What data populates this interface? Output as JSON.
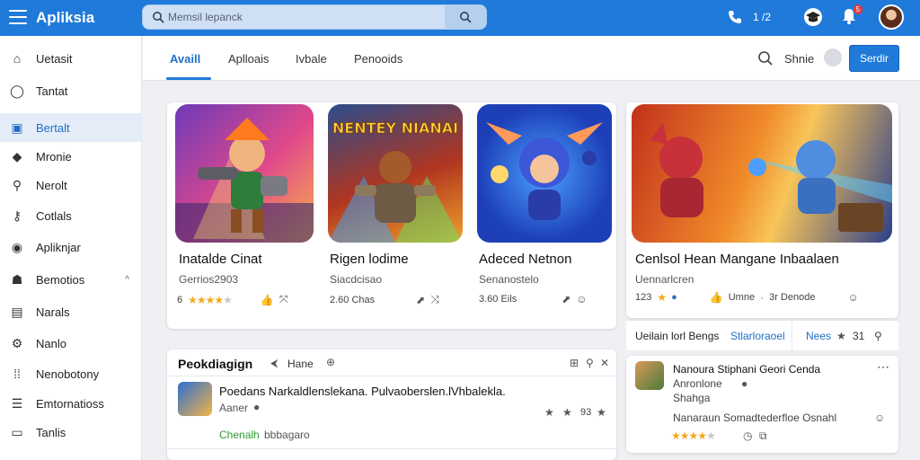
{
  "header": {
    "app_title": "Apliksia",
    "search_placeholder": "Memsil lepanck",
    "phone_number": "1 /2",
    "notification_count": "5"
  },
  "sidebar": {
    "items": [
      {
        "label": "Uetasit",
        "icon": "home-icon"
      },
      {
        "label": "Tantat",
        "icon": "chat-icon"
      },
      {
        "label": "Bertalt",
        "icon": "grid-icon",
        "active": true
      },
      {
        "label": "Mronie",
        "icon": "tag-icon"
      },
      {
        "label": "Nerolt",
        "icon": "search-icon"
      },
      {
        "label": "Cotlals",
        "icon": "key-icon"
      },
      {
        "label": "Apliknjar",
        "icon": "eye-icon"
      },
      {
        "label": "Bemotios",
        "icon": "users-icon",
        "chevron": "^"
      },
      {
        "label": "Narals",
        "icon": "image-icon"
      },
      {
        "label": "Nanlo",
        "icon": "settings-icon"
      },
      {
        "label": "Nenobotony",
        "icon": "apps-icon"
      },
      {
        "label": "Emtornatioss",
        "icon": "list-icon"
      },
      {
        "label": "Tanlis",
        "icon": "monitor-icon"
      }
    ]
  },
  "tabs": {
    "items": [
      {
        "label": "Availl",
        "active": true
      },
      {
        "label": "Aplloais"
      },
      {
        "label": "Ivbale"
      },
      {
        "label": "Penooids"
      }
    ],
    "search_link": "Shnie",
    "button_label": "Serdir"
  },
  "featured": {
    "games": [
      {
        "name": "Inatalde Cinat",
        "developer": "Gerrios2903",
        "rating_text": "6",
        "rating": 4,
        "stats": ""
      },
      {
        "name": "Rigen lodime",
        "developer": "Siacdcisao",
        "rating_text": "",
        "rating": 0,
        "stats": "2.60 Chas"
      },
      {
        "name": "Adeced Netnon",
        "developer": "Senanostelo",
        "rating_text": "",
        "rating": 0,
        "stats": "3.60 Eils"
      }
    ],
    "wide": {
      "name": "Cenlsol Hean Manganе Inbaalaen",
      "developer": "Uennarlcren",
      "rating_text": "123",
      "meta_1": "Umne",
      "meta_2": "3r Denode"
    },
    "thumb_titles": [
      "NENTEY NIANAI"
    ]
  },
  "strip": {
    "label": "Ueilain lorl Bengs",
    "link": "Stlarloraoel",
    "news": "Nees",
    "count": "31"
  },
  "lower_left": {
    "title": "Peokdiagign",
    "action": "Hane",
    "item_title": "Poedans Narkaldlenslekana. Pulvaoberslen.lVhbalekla.",
    "item_sub": "Aaner",
    "item_tag": "Chenalh",
    "item_tag_2": "bbbagaro",
    "item_count": "93"
  },
  "lower_right": {
    "title": "Nanoura Stiphani Geori Cenda",
    "sub": "Anronlone",
    "sub2": "Shahga",
    "line": "Nanaraun Somadtederfloe Osnahl"
  },
  "colors": {
    "accent": "#1f7ad9",
    "active_bg": "#e4edf7",
    "star": "#f3a91c",
    "link": "#1f6fc7",
    "tag_green": "#2e9d2e"
  }
}
